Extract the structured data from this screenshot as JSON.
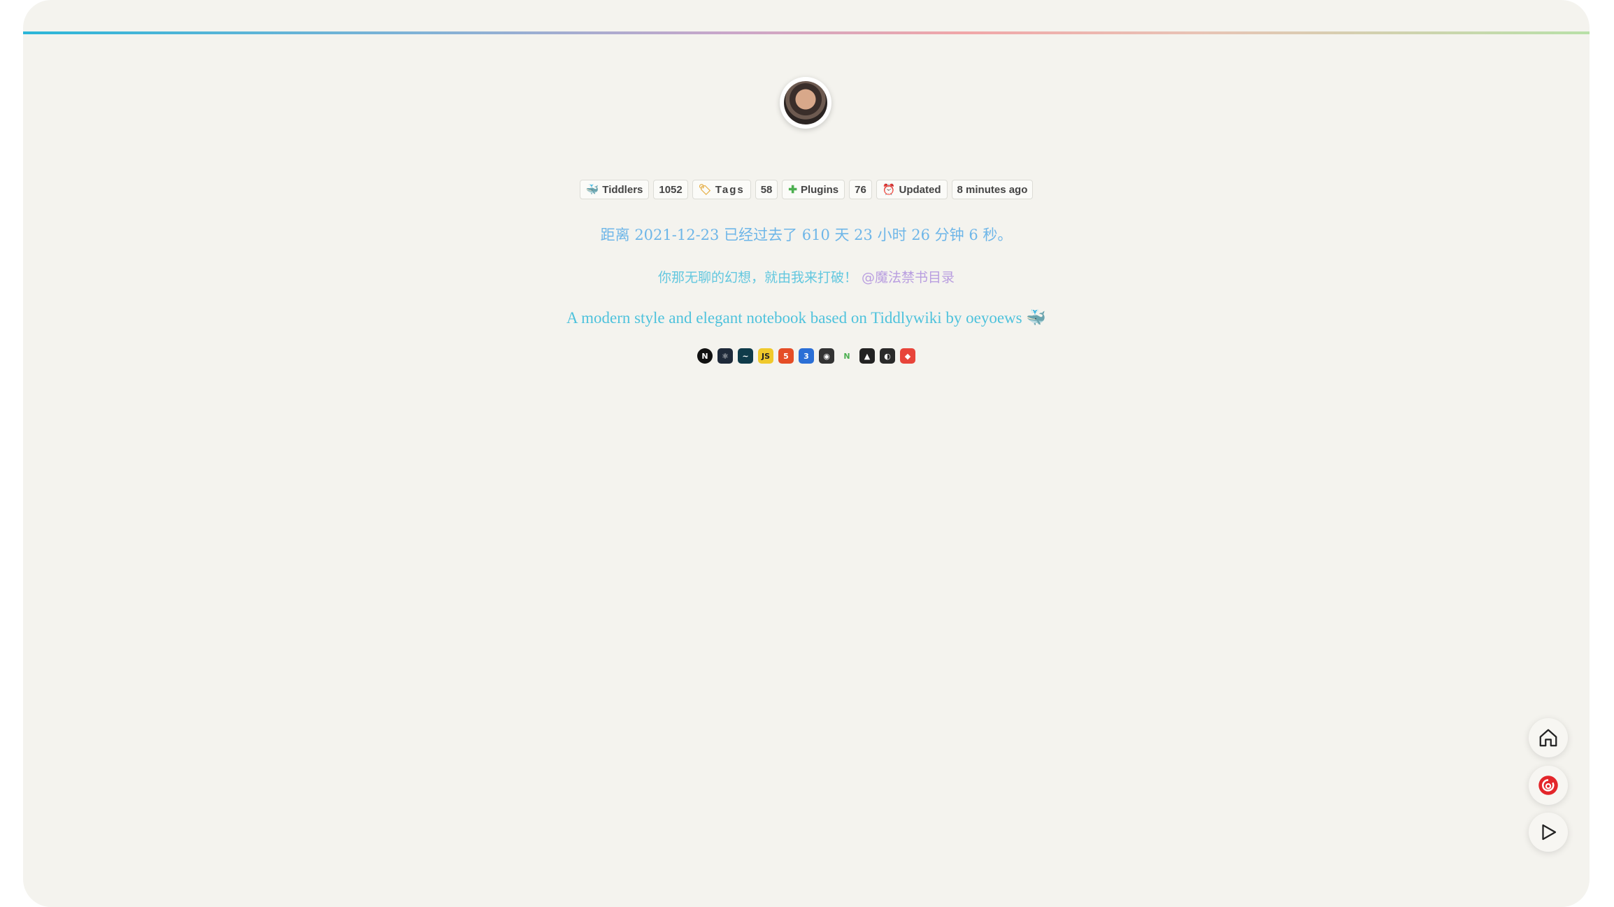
{
  "stats": [
    {
      "icon": "whale-icon",
      "label": "Tiddlers",
      "value": "1052"
    },
    {
      "icon": "tag-icon",
      "label": "Tags",
      "value": "58"
    },
    {
      "icon": "puzzle-icon",
      "label": "Plugins",
      "value": "76"
    },
    {
      "icon": "clock-icon",
      "label": "Updated",
      "value": "8 minutes ago"
    }
  ],
  "countdown": {
    "text": "距离 2021-12-23 已经过去了 610 天 23 小时 26 分钟 6 秒。"
  },
  "motto": {
    "text": "你那无聊的幻想，就由我来打破！",
    "handle": "@魔法禁书目录"
  },
  "tagline": {
    "text": "A modern style and elegant notebook based on Tiddlywiki by oeyoews",
    "emoji": "🐳"
  },
  "tech_icons": [
    {
      "name": "nextjs-icon",
      "glyph": "N",
      "bg": "#111111"
    },
    {
      "name": "react-icon",
      "glyph": "⚛",
      "bg": "#1f2a3a"
    },
    {
      "name": "tailwind-icon",
      "glyph": "~",
      "bg": "#0f3b4a"
    },
    {
      "name": "javascript-icon",
      "glyph": "JS",
      "bg": "#f0c92b"
    },
    {
      "name": "html5-icon",
      "glyph": "5",
      "bg": "#e54d26"
    },
    {
      "name": "css3-icon",
      "glyph": "3",
      "bg": "#2b6fd6"
    },
    {
      "name": "github-icon",
      "glyph": "◉",
      "bg": "#333333"
    },
    {
      "name": "nodejs-icon",
      "glyph": "N",
      "bg": "#f4f3ee"
    },
    {
      "name": "linux-icon",
      "glyph": "▲",
      "bg": "#222222"
    },
    {
      "name": "neovim-icon",
      "glyph": "◐",
      "bg": "#2a2a2a"
    },
    {
      "name": "git-icon",
      "glyph": "◆",
      "bg": "#e8443a"
    }
  ],
  "fab": {
    "home": "home-icon",
    "music": "netease-music-icon",
    "play": "play-icon"
  },
  "colors": {
    "background": "#f4f3ee",
    "accent_blue": "#4ec2dc",
    "accent_purple": "#b69ae0"
  }
}
